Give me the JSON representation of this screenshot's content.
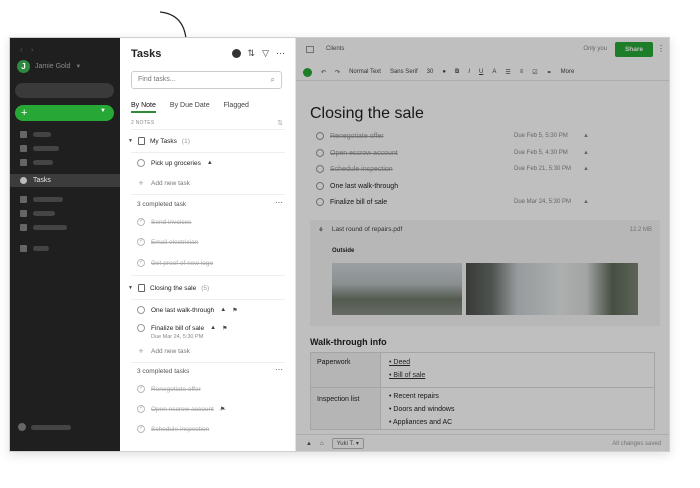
{
  "sidebar": {
    "user_initial": "J",
    "user_name": "Jamie Gold",
    "new_plus": "+",
    "active_item": "Tasks"
  },
  "tasks_panel": {
    "title": "Tasks",
    "search_placeholder": "Find tasks...",
    "tabs": [
      "By Note",
      "By Due Date",
      "Flagged"
    ],
    "notes_count": "2 NOTES",
    "groups": [
      {
        "name": "My Tasks",
        "count": "(1)",
        "tasks": [
          {
            "label": "Pick up groceries"
          }
        ],
        "add_label": "Add new task",
        "completed_label": "3 completed task",
        "completed": [
          "Send invoices",
          "Email electrician",
          "Get proof of new logo"
        ]
      },
      {
        "name": "Closing the sale",
        "count": "(5)",
        "tasks": [
          {
            "label": "One last walk-through"
          },
          {
            "label": "Finalize bill of sale",
            "due": "Due Mar 24, 5:30 PM"
          }
        ],
        "add_label": "Add new task",
        "completed_label": "3 completed tasks",
        "completed": [
          "Renegotiate offer",
          "Open escrow account",
          "Schedule inspection"
        ]
      }
    ]
  },
  "editor": {
    "notebook": "Clients",
    "only_you": "Only you",
    "share": "Share",
    "toolbar": {
      "style": "Normal Text",
      "font": "Sans Serif",
      "size": "30",
      "more": "More"
    },
    "title": "Closing the sale",
    "tasks": [
      {
        "label": "Renegotiate offer",
        "done": true,
        "due": "Due Feb 5, 5:30 PM"
      },
      {
        "label": "Open escrow account",
        "done": true,
        "due": "Due Feb 5, 4:30 PM"
      },
      {
        "label": "Schedule inspection",
        "done": true,
        "due": "Due Feb 21, 5:30 PM"
      },
      {
        "label": "One last walk-through",
        "done": false,
        "due": ""
      },
      {
        "label": "Finalize bill of sale",
        "done": false,
        "due": "Due Mar 24, 5:30 PM"
      }
    ],
    "attachment": {
      "name": "Last round of repairs.pdf",
      "size": "12.2 MB",
      "caption": "Outside"
    },
    "section": "Walk-through info",
    "table": {
      "row1_head": "Paperwork",
      "row1_items": [
        "Deed",
        "Bill of sale"
      ],
      "row2_head": "Inspection list",
      "row2_items": [
        "Recent repairs",
        "Doors and windows",
        "Appliances and AC"
      ]
    },
    "footer_user": "Yuki T.",
    "saved": "All changes saved"
  },
  "colors": {
    "accent_green": "#27a736",
    "sidebar_bg": "#1f1f1f"
  }
}
